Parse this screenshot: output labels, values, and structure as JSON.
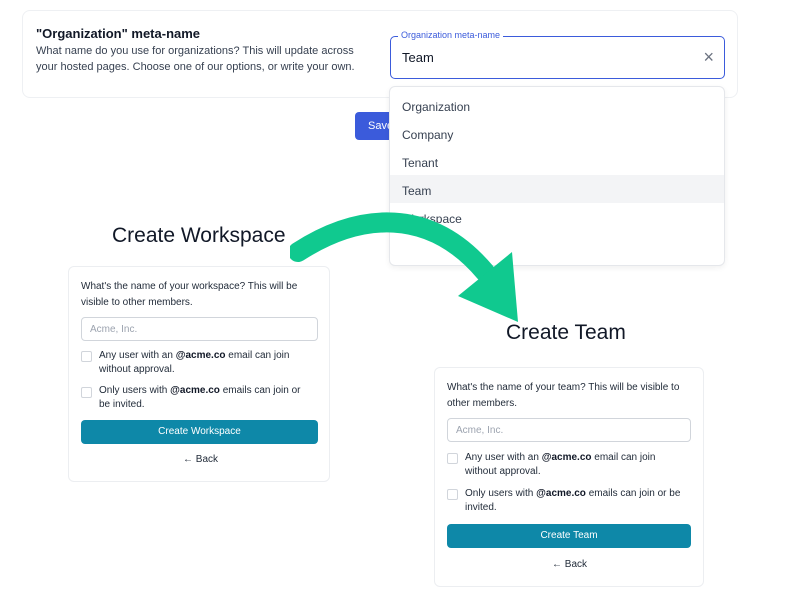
{
  "settings": {
    "title": "\"Organization\" meta-name",
    "description": "What name do you use for organizations? This will update across your hosted pages. Choose one of our options, or write your own.",
    "save_label": "Save"
  },
  "org_input": {
    "label": "Organization meta-name",
    "value": "Team",
    "clear_icon": "×"
  },
  "dropdown": {
    "options": [
      "Organization",
      "Company",
      "Tenant",
      "Team",
      "Workspace"
    ],
    "selected": "Team"
  },
  "colors": {
    "accent_blue": "#3b5bdb",
    "primary_teal": "#0e88a8",
    "arrow_green": "#10c98f"
  },
  "workspace_form": {
    "heading": "Create Workspace",
    "question": "What's the name of your workspace? This will be visible to other members.",
    "name_placeholder": "Acme, Inc.",
    "option1_pre": "Any user with an ",
    "option1_domain": "@acme.co",
    "option1_post": " email can join without approval.",
    "option2_pre": "Only users with ",
    "option2_domain": "@acme.co",
    "option2_post": " emails can join or be invited.",
    "submit_label": "Create Workspace",
    "back_label": "← Back"
  },
  "team_form": {
    "heading": "Create Team",
    "question": "What's the name of your team? This will be visible to other members.",
    "name_placeholder": "Acme, Inc.",
    "option1_pre": "Any user with an ",
    "option1_domain": "@acme.co",
    "option1_post": " email can join without approval.",
    "option2_pre": "Only users with ",
    "option2_domain": "@acme.co",
    "option2_post": " emails can join or be invited.",
    "submit_label": "Create Team",
    "back_label": "← Back"
  }
}
